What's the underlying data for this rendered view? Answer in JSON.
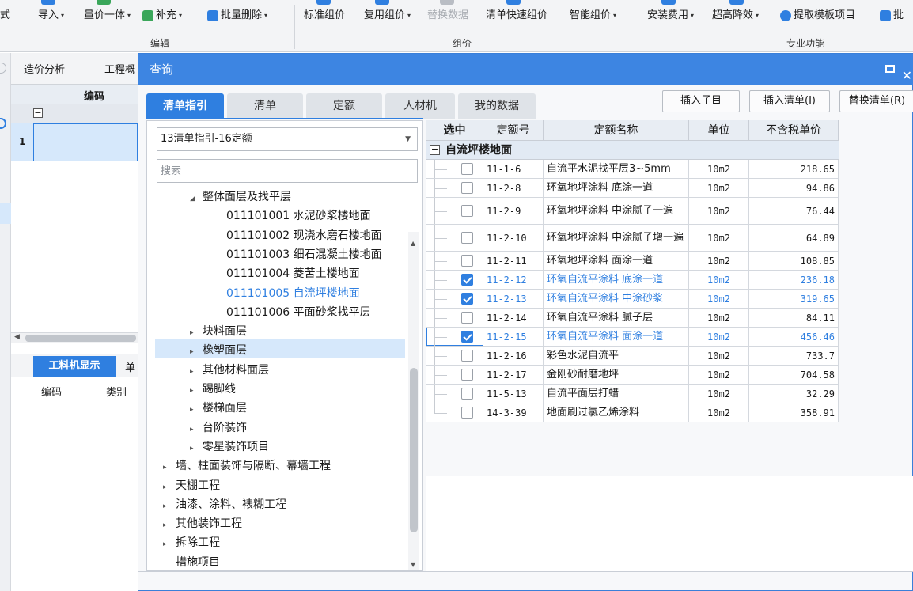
{
  "ribbon": {
    "items": [
      {
        "id": "style",
        "label": "式",
        "caret": false,
        "disabled": false
      },
      {
        "id": "import",
        "label": "导入",
        "caret": true,
        "disabled": false
      },
      {
        "id": "qty-price",
        "label": "量价一体",
        "caret": true,
        "disabled": false
      },
      {
        "id": "supplement",
        "label": "补充",
        "caret": true,
        "disabled": false
      },
      {
        "id": "batch-delete",
        "label": "批量删除",
        "caret": true,
        "disabled": false
      },
      {
        "id": "std-pricing",
        "label": "标准组价",
        "caret": false,
        "disabled": false
      },
      {
        "id": "reuse-pricing",
        "label": "复用组价",
        "caret": true,
        "disabled": false
      },
      {
        "id": "replace-data",
        "label": "替换数据",
        "caret": false,
        "disabled": true
      },
      {
        "id": "quick-pricing",
        "label": "清单快速组价",
        "caret": false,
        "disabled": false
      },
      {
        "id": "smart-pricing",
        "label": "智能组价",
        "caret": true,
        "disabled": false
      },
      {
        "id": "install-fee",
        "label": "安装费用",
        "caret": true,
        "disabled": false
      },
      {
        "id": "super-height",
        "label": "超高降效",
        "caret": true,
        "disabled": false
      },
      {
        "id": "extract-template",
        "label": "提取模板项目",
        "caret": false,
        "disabled": false
      },
      {
        "id": "batch-more",
        "label": "批",
        "caret": false,
        "disabled": false
      }
    ],
    "groups": {
      "edit": "编辑",
      "pricing": "组价",
      "special": "专业功能"
    }
  },
  "background": {
    "tabs": {
      "cost_analysis": "造价分析",
      "project": "工程概"
    },
    "grid_header": "编码",
    "row_number": "1",
    "tree_toggle": "−",
    "lower_tabs": {
      "labor_display": "工料机显示",
      "unit": "单"
    },
    "lower_headers": {
      "code": "编码",
      "category": "类别"
    }
  },
  "dialog": {
    "title": "查询",
    "tabs": [
      {
        "id": "bill-guide",
        "label": "清单指引",
        "active": true
      },
      {
        "id": "bill",
        "label": "清单",
        "active": false
      },
      {
        "id": "quota",
        "label": "定额",
        "active": false
      },
      {
        "id": "labor-material",
        "label": "人材机",
        "active": false
      },
      {
        "id": "my-data",
        "label": "我的数据",
        "active": false
      }
    ],
    "actions": {
      "insert_child": "插入子目",
      "insert_bill": "插入清单(I)",
      "replace_bill": "替换清单(R)"
    },
    "library_select": "13清单指引-16定额",
    "search_placeholder": "搜索",
    "tree": [
      {
        "label": "整体面层及找平层",
        "level": 1,
        "arrow": "▲",
        "expanded": true,
        "selected": false
      },
      {
        "label": "011101001  水泥砂浆楼地面",
        "level": 2,
        "arrow": "",
        "selected": false
      },
      {
        "label": "011101002  现浇水磨石楼地面",
        "level": 2,
        "arrow": "",
        "selected": false
      },
      {
        "label": "011101003  细石混凝土楼地面",
        "level": 2,
        "arrow": "",
        "selected": false
      },
      {
        "label": "011101004  菱苦土楼地面",
        "level": 2,
        "arrow": "",
        "selected": false
      },
      {
        "label": "011101005  自流坪楼地面",
        "level": 2,
        "arrow": "",
        "selected": true
      },
      {
        "label": "011101006  平面砂浆找平层",
        "level": 2,
        "arrow": "",
        "selected": false
      },
      {
        "label": "块料面层",
        "level": 1,
        "arrow": "▶",
        "selected": false
      },
      {
        "label": "橡塑面层",
        "level": 1,
        "arrow": "▶",
        "selected": false
      },
      {
        "label": "其他材料面层",
        "level": 1,
        "arrow": "▶",
        "selected": false
      },
      {
        "label": "踢脚线",
        "level": 1,
        "arrow": "▶",
        "selected": false
      },
      {
        "label": "楼梯面层",
        "level": 1,
        "arrow": "▶",
        "selected": false
      },
      {
        "label": "台阶装饰",
        "level": 1,
        "arrow": "▶",
        "selected": false
      },
      {
        "label": "零星装饰项目",
        "level": 1,
        "arrow": "▶",
        "selected": false
      },
      {
        "label": "墙、柱面装饰与隔断、幕墙工程",
        "level": 0,
        "arrow": "▶",
        "selected": false
      },
      {
        "label": "天棚工程",
        "level": 0,
        "arrow": "▶",
        "selected": false
      },
      {
        "label": "油漆、涂料、裱糊工程",
        "level": 0,
        "arrow": "▶",
        "selected": false
      },
      {
        "label": "其他装饰工程",
        "level": 0,
        "arrow": "▶",
        "selected": false
      },
      {
        "label": "拆除工程",
        "level": 0,
        "arrow": "▶",
        "selected": false
      },
      {
        "label": "措施项目",
        "level": 0,
        "arrow": "",
        "selected": false
      }
    ],
    "grid": {
      "headers": {
        "select": "选中",
        "code": "定额号",
        "name": "定额名称",
        "unit": "单位",
        "price": "不含税单价"
      },
      "group": {
        "toggle": "−",
        "label": "自流坪楼地面"
      },
      "rows": [
        {
          "code": "11-1-6",
          "name": "自流平水泥找平层3~5mm",
          "unit": "10m2",
          "price": "218.65",
          "checked": false,
          "focus": false
        },
        {
          "code": "11-2-8",
          "name": "环氧地坪涂料 底涂一道",
          "unit": "10m2",
          "price": "94.86",
          "checked": false,
          "focus": false
        },
        {
          "code": "11-2-9",
          "name": "环氧地坪涂料 中涂腻子一遍",
          "unit": "10m2",
          "price": "76.44",
          "checked": false,
          "focus": false,
          "tall": true
        },
        {
          "code": "11-2-10",
          "name": "环氧地坪涂料 中涂腻子增一遍",
          "unit": "10m2",
          "price": "64.89",
          "checked": false,
          "focus": false,
          "tall": true
        },
        {
          "code": "11-2-11",
          "name": "环氧地坪涂料 面涂一道",
          "unit": "10m2",
          "price": "108.85",
          "checked": false,
          "focus": false
        },
        {
          "code": "11-2-12",
          "name": "环氧自流平涂料 底涂一道",
          "unit": "10m2",
          "price": "236.18",
          "checked": true,
          "focus": false
        },
        {
          "code": "11-2-13",
          "name": "环氧自流平涂料 中涂砂浆",
          "unit": "10m2",
          "price": "319.65",
          "checked": true,
          "focus": false
        },
        {
          "code": "11-2-14",
          "name": "环氧自流平涂料 腻子层",
          "unit": "10m2",
          "price": "84.11",
          "checked": false,
          "focus": false
        },
        {
          "code": "11-2-15",
          "name": "环氧自流平涂料 面涂一道",
          "unit": "10m2",
          "price": "456.46",
          "checked": true,
          "focus": true
        },
        {
          "code": "11-2-16",
          "name": "彩色水泥自流平",
          "unit": "10m2",
          "price": "733.7",
          "checked": false,
          "focus": false
        },
        {
          "code": "11-2-17",
          "name": "金刚砂耐磨地坪",
          "unit": "10m2",
          "price": "704.58",
          "checked": false,
          "focus": false
        },
        {
          "code": "11-5-13",
          "name": "自流平面层打蜡",
          "unit": "10m2",
          "price": "32.29",
          "checked": false,
          "focus": false
        },
        {
          "code": "14-3-39",
          "name": "地面刷过氯乙烯涂料",
          "unit": "10m2",
          "price": "358.91",
          "checked": false,
          "focus": false
        }
      ]
    }
  },
  "colors": {
    "accent": "#2f7fe0",
    "title_bar": "#3d85e2",
    "selected_row": "#d6e8fb"
  }
}
